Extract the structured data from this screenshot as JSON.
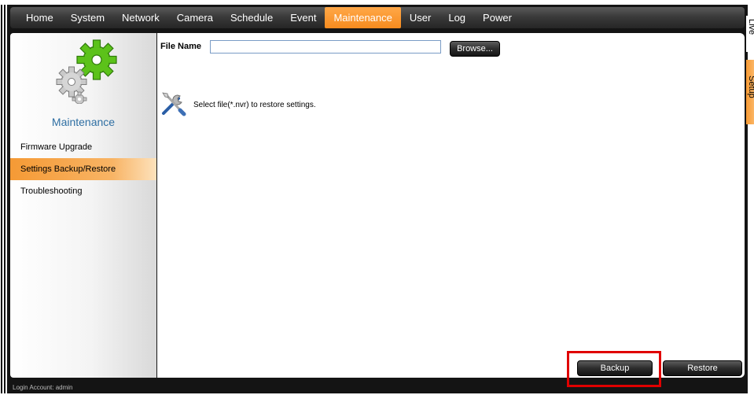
{
  "topnav": {
    "items": [
      {
        "label": "Home"
      },
      {
        "label": "System"
      },
      {
        "label": "Network"
      },
      {
        "label": "Camera"
      },
      {
        "label": "Schedule"
      },
      {
        "label": "Event"
      },
      {
        "label": "Maintenance",
        "active": true
      },
      {
        "label": "User"
      },
      {
        "label": "Log"
      },
      {
        "label": "Power"
      }
    ]
  },
  "sidebar": {
    "title": "Maintenance",
    "icon": "gears-icon",
    "items": [
      {
        "label": "Firmware Upgrade"
      },
      {
        "label": "Settings Backup/Restore",
        "active": true
      },
      {
        "label": "Troubleshooting"
      }
    ]
  },
  "main": {
    "file_name_label": "File Name",
    "file_input_value": "",
    "browse_label": "Browse...",
    "hint_icon": "tools-icon",
    "restore_hint": "Select file(*.nvr) to restore settings.",
    "backup_label": "Backup",
    "restore_label": "Restore"
  },
  "status": {
    "login_account": "Login Account: admin"
  },
  "side_tabs": {
    "live": "Live",
    "setup": "Setup"
  },
  "colors": {
    "accent": "#f68b1f",
    "sidebar_title": "#2f6fa3",
    "gear_green": "#5cc21a",
    "highlight": "#e00000"
  }
}
